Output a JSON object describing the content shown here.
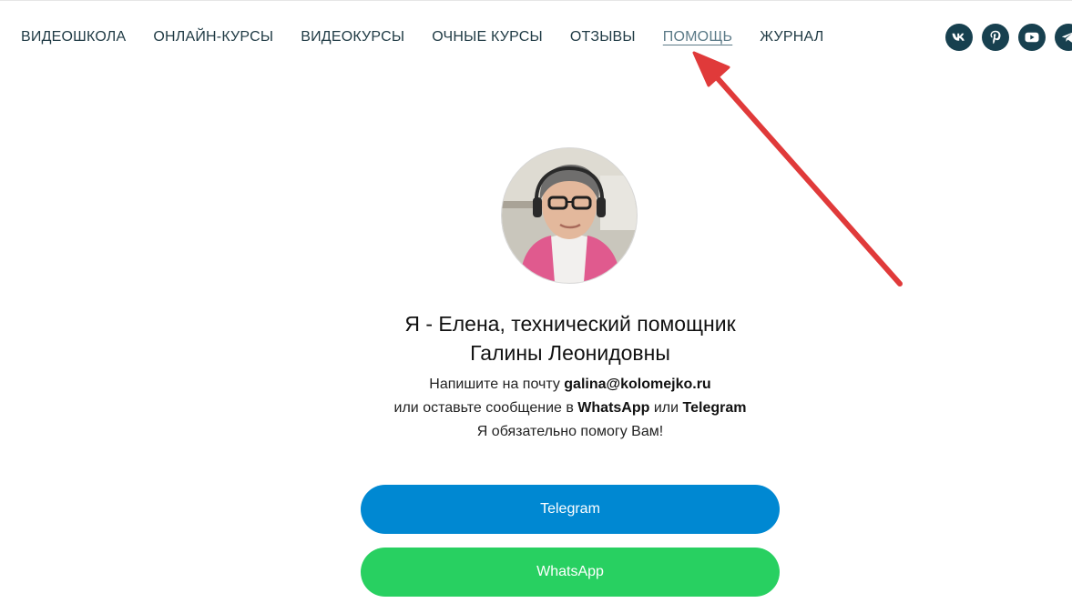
{
  "nav": {
    "items": [
      {
        "label": "ВИДЕОШКОЛА",
        "active": false
      },
      {
        "label": "ОНЛАЙН-КУРСЫ",
        "active": false
      },
      {
        "label": "ВИДЕОКУРСЫ",
        "active": false
      },
      {
        "label": "ОЧНЫЕ КУРСЫ",
        "active": false
      },
      {
        "label": "ОТЗЫВЫ",
        "active": false
      },
      {
        "label": "ПОМОЩЬ",
        "active": true
      },
      {
        "label": "ЖУРНАЛ",
        "active": false
      }
    ]
  },
  "socials": [
    {
      "icon": "vk-icon"
    },
    {
      "icon": "pinterest-icon"
    },
    {
      "icon": "youtube-icon"
    },
    {
      "icon": "telegram-icon"
    }
  ],
  "profile": {
    "headline_line1": "Я - Елена, технический помощник",
    "headline_line2": "Галины Леонидовны",
    "text_line1_prefix": "Напишите на почту ",
    "email": "galina@kolomejko.ru",
    "text_line2_prefix": "или оставьте сообщение в ",
    "whatsapp_word": "WhatsApp",
    "text_line2_middle": " или ",
    "telegram_word": "Telegram",
    "text_line3": "Я обязательно помогу Вам!"
  },
  "buttons": {
    "telegram_label": "Telegram",
    "whatsapp_label": "WhatsApp"
  },
  "colors": {
    "nav_text": "#1f3a44",
    "social_bg": "#17404f",
    "telegram_button": "#0088d2",
    "whatsapp_button": "#28d061",
    "annotation_arrow": "#e03a3a"
  }
}
